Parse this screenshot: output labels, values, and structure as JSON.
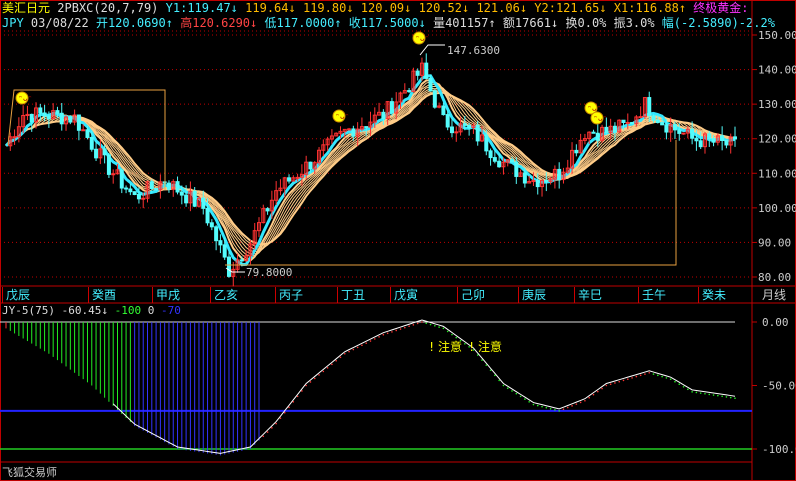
{
  "header": {
    "name": "美汇日元",
    "formula": "2PBXC(20,7,79)",
    "y1_label": "Y1:119.47",
    "y1_arrow": "↓",
    "v2": "119.64",
    "v2_arrow": "↓",
    "v3": "119.80",
    "v3_arrow": "↓",
    "v4": "120.09",
    "v4_arrow": "↓",
    "v5": "120.52",
    "v5_arrow": "↓",
    "v6": "121.06",
    "v6_arrow": "↓",
    "y2_label": "Y2:121.65",
    "y2_arrow": "↓",
    "x1_label": "X1:116.88",
    "x1_arrow": "↑",
    "signal": "终极黄金:"
  },
  "quote": {
    "symbol": "JPY",
    "date": "03/08/22",
    "open": "开120.0690",
    "open_arrow": "↑",
    "high": "高120.6290",
    "high_arrow": "↓",
    "low": "低117.0000",
    "low_arrow": "↑",
    "close": "收117.5000",
    "close_arrow": "↓",
    "volume": "量401157",
    "volume_arrow": "↑",
    "amount": "额17661",
    "amount_arrow": "↓",
    "turnover": "换0.0%",
    "amplitude": "振3.0%",
    "change": "幅(-2.5890)-2.2%"
  },
  "year_labels": [
    "戊辰",
    "癸酉",
    "甲戌",
    "乙亥",
    "丙子",
    "丁丑",
    "戊寅",
    "己卯",
    "庚辰",
    "辛巳",
    "壬午",
    "癸未"
  ],
  "period": "月线",
  "indicator": {
    "name": "JY-5(75)",
    "value": "-60.45",
    "arrow": "↓",
    "l1": "-100",
    "l2": "0",
    "l3": "-70",
    "notes": [
      "注意",
      "注意"
    ]
  },
  "footer": "飞狐交易师",
  "colors": {
    "up": "#ff3232",
    "down": "#54fcfc",
    "ribbon": "#ffcc88",
    "fast": "#33e8ff",
    "grid": "#c00000"
  },
  "chart_data": [
    {
      "type": "candlestick",
      "title": "美汇日元 月线",
      "ylim": [
        77,
        153
      ],
      "yticks": [
        150,
        140,
        130,
        120,
        110,
        100,
        90,
        80
      ],
      "ytick_labels": [
        "150.00",
        "140.00",
        "130.00",
        "120.00",
        "110.00",
        "100.00",
        "90.00",
        "80.00"
      ],
      "key_closes": [
        [
          0,
          118
        ],
        [
          4,
          127
        ],
        [
          9,
          127
        ],
        [
          16,
          126
        ],
        [
          23,
          113
        ],
        [
          30,
          103
        ],
        [
          37,
          108
        ],
        [
          46,
          100
        ],
        [
          52,
          82
        ],
        [
          57,
          90
        ],
        [
          63,
          105
        ],
        [
          70,
          112
        ],
        [
          79,
          122
        ],
        [
          88,
          127
        ],
        [
          97,
          140
        ],
        [
          102,
          125
        ],
        [
          109,
          122
        ],
        [
          116,
          113
        ],
        [
          123,
          108
        ],
        [
          129,
          110
        ],
        [
          135,
          122
        ],
        [
          140,
          122
        ],
        [
          145,
          124
        ],
        [
          149,
          130
        ],
        [
          153,
          125
        ],
        [
          160,
          120
        ],
        [
          170,
          118
        ]
      ],
      "annotations": [
        "147.6300",
        "79.8000"
      ]
    },
    {
      "type": "line",
      "title": "JY-5(75)",
      "ylim": [
        -115,
        5
      ],
      "yticks": [
        0,
        -50,
        -100
      ],
      "ytick_labels": [
        "0.00",
        "-50.00",
        "-100.0"
      ],
      "hlines": [
        0,
        -70,
        -100
      ],
      "key_values": [
        [
          0,
          -5
        ],
        [
          10,
          -25
        ],
        [
          20,
          -50
        ],
        [
          30,
          -82
        ],
        [
          40,
          -100
        ],
        [
          50,
          -105
        ],
        [
          57,
          -100
        ],
        [
          63,
          -80
        ],
        [
          70,
          -50
        ],
        [
          79,
          -25
        ],
        [
          88,
          -10
        ],
        [
          97,
          0
        ],
        [
          102,
          -5
        ],
        [
          109,
          -22
        ],
        [
          116,
          -50
        ],
        [
          123,
          -65
        ],
        [
          129,
          -70
        ],
        [
          135,
          -62
        ],
        [
          140,
          -50
        ],
        [
          145,
          -45
        ],
        [
          150,
          -40
        ],
        [
          155,
          -45
        ],
        [
          160,
          -55
        ],
        [
          170,
          -60
        ]
      ]
    }
  ]
}
